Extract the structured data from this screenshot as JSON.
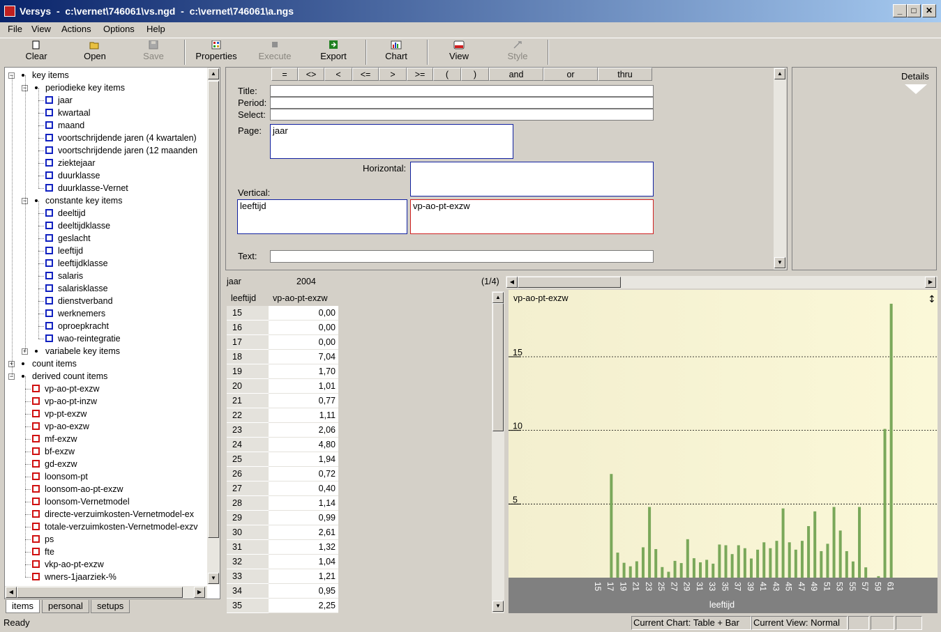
{
  "window": {
    "title": "Versys  -  c:\\vernet\\746061\\vs.ngd  -  c:\\vernet\\746061\\a.ngs",
    "minimize": "_",
    "maximize": "□",
    "close": "✕"
  },
  "menu": [
    "File",
    "View",
    "Actions",
    "Options",
    "Help"
  ],
  "toolbar": {
    "clear": "Clear",
    "open": "Open",
    "save": "Save",
    "properties": "Properties",
    "execute": "Execute",
    "export": "Export",
    "chart": "Chart",
    "view": "View",
    "style": "Style"
  },
  "tree": {
    "key_items": "key items",
    "periodic": "periodieke key items",
    "periodic_items": [
      "jaar",
      "kwartaal",
      "maand",
      "voortschrijdende jaren (4 kwartalen)",
      "voortschrijdende jaren (12 maanden",
      "ziektejaar",
      "duurklasse",
      "duurklasse-Vernet"
    ],
    "constant": "constante key items",
    "constant_items": [
      "deeltijd",
      "deeltijdklasse",
      "geslacht",
      "leeftijd",
      "leeftijdklasse",
      "salaris",
      "salarisklasse",
      "dienstverband",
      "werknemers",
      "oproepkracht",
      "wao-reintegratie"
    ],
    "variable": "variabele key items",
    "count": "count items",
    "derived": "derived count items",
    "derived_items": [
      "vp-ao-pt-exzw",
      "vp-ao-pt-inzw",
      "vp-pt-exzw",
      "vp-ao-exzw",
      "mf-exzw",
      "bf-exzw",
      "gd-exzw",
      "loonsom-pt",
      "loonsom-ao-pt-exzw",
      "loonsom-Vernetmodel",
      "directe-verzuimkosten-Vernetmodel-ex",
      "totale-verzuimkosten-Vernetmodel-exzv",
      "ps",
      "fte",
      "vkp-ao-pt-exzw",
      "wners-1jaarziek-%"
    ]
  },
  "tabs": [
    "items",
    "personal",
    "setups"
  ],
  "operators": [
    "=",
    "<>",
    "<",
    "<=",
    ">",
    ">=",
    "(",
    ")",
    "and",
    "or",
    "thru"
  ],
  "query": {
    "title_label": "Title:",
    "period_label": "Period:",
    "select_label": "Select:",
    "page_label": "Page:",
    "page_value": "jaar",
    "horizontal_label": "Horizontal:",
    "vertical_label": "Vertical:",
    "vertical_value": "leeftijd",
    "count_value": "vp-ao-pt-exzw",
    "text_label": "Text:"
  },
  "details": {
    "label": "Details"
  },
  "table": {
    "page_key": "jaar",
    "page_value": "2004",
    "page_index": "(1/4)",
    "col_row": "leeftijd",
    "col_val": "vp-ao-pt-exzw",
    "rows": [
      [
        "15",
        "0,00"
      ],
      [
        "16",
        "0,00"
      ],
      [
        "17",
        "0,00"
      ],
      [
        "18",
        "7,04"
      ],
      [
        "19",
        "1,70"
      ],
      [
        "20",
        "1,01"
      ],
      [
        "21",
        "0,77"
      ],
      [
        "22",
        "1,11"
      ],
      [
        "23",
        "2,06"
      ],
      [
        "24",
        "4,80"
      ],
      [
        "25",
        "1,94"
      ],
      [
        "26",
        "0,72"
      ],
      [
        "27",
        "0,40"
      ],
      [
        "28",
        "1,14"
      ],
      [
        "29",
        "0,99"
      ],
      [
        "30",
        "2,61"
      ],
      [
        "31",
        "1,32"
      ],
      [
        "32",
        "1,04"
      ],
      [
        "33",
        "1,21"
      ],
      [
        "34",
        "0,95"
      ],
      [
        "35",
        "2,25"
      ]
    ]
  },
  "chart_data": {
    "type": "bar",
    "title": "vp-ao-pt-exzw",
    "xlabel": "leeftijd",
    "ylabel": "",
    "ylim": [
      0,
      18.5
    ],
    "yticks": [
      5,
      10,
      15
    ],
    "grid": true,
    "colors": {
      "bar": "#7aa85a",
      "background_left": "#f3efcf",
      "background_right": "#fbf8d8",
      "axis_band": "#808080"
    },
    "xtick_labels": [
      "15",
      "17",
      "19",
      "21",
      "23",
      "25",
      "27",
      "29",
      "31",
      "33",
      "35",
      "37",
      "39",
      "41",
      "43",
      "45",
      "47",
      "49",
      "51",
      "53",
      "55",
      "57",
      "59",
      "61"
    ],
    "categories": [
      15,
      16,
      17,
      18,
      19,
      20,
      21,
      22,
      23,
      24,
      25,
      26,
      27,
      28,
      29,
      30,
      31,
      32,
      33,
      34,
      35,
      36,
      37,
      38,
      39,
      40,
      41,
      42,
      43,
      44,
      45,
      46,
      47,
      48,
      49,
      50,
      51,
      52,
      53,
      54,
      55,
      56,
      57,
      58,
      59,
      60,
      61,
      62,
      63,
      64
    ],
    "values": [
      0,
      0,
      0,
      7.04,
      1.7,
      1.01,
      0.77,
      1.11,
      2.06,
      4.8,
      1.94,
      0.72,
      0.4,
      1.14,
      0.99,
      2.61,
      1.32,
      1.04,
      1.21,
      0.95,
      2.25,
      2.2,
      1.6,
      2.2,
      2.0,
      1.3,
      1.9,
      2.4,
      2.0,
      2.5,
      4.7,
      2.4,
      1.9,
      2.5,
      3.5,
      4.5,
      1.8,
      2.3,
      4.8,
      3.2,
      1.8,
      1.1,
      4.8,
      0.7,
      0.0,
      0.1,
      10.1,
      18.6,
      0,
      0
    ]
  },
  "status": {
    "ready": "Ready",
    "current_chart": "Current Chart: Table + Bar",
    "current_view": "Current View: Normal"
  }
}
